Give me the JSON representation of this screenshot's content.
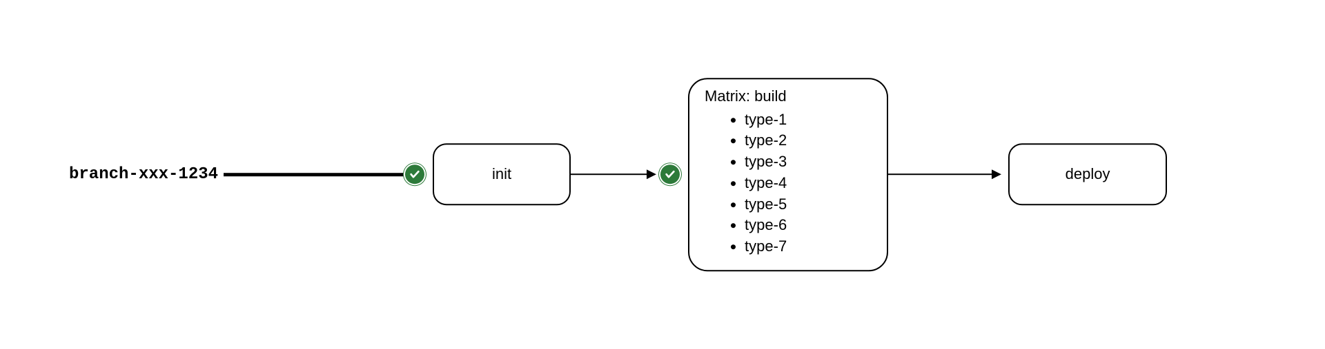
{
  "branch": {
    "name": "branch-xxx-1234"
  },
  "stages": {
    "init": {
      "label": "init",
      "status": "success"
    },
    "matrix": {
      "title": "Matrix: build",
      "status": "success",
      "items": [
        "type-1",
        "type-2",
        "type-3",
        "type-4",
        "type-5",
        "type-6",
        "type-7"
      ]
    },
    "deploy": {
      "label": "deploy"
    }
  }
}
